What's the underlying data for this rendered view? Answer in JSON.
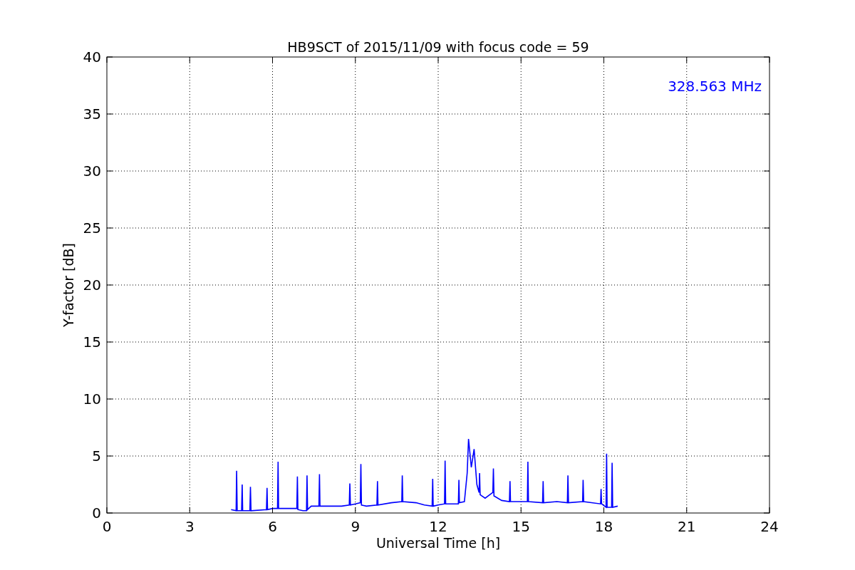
{
  "chart_data": {
    "type": "line",
    "title": "HB9SCT of 2015/11/09 with focus code = 59",
    "xlabel": "Universal Time [h]",
    "ylabel": "Y-factor [dB]",
    "x": [
      4.5,
      4.68,
      4.7,
      4.72,
      4.88,
      4.9,
      4.92,
      5.18,
      5.2,
      5.22,
      5.78,
      5.8,
      5.82,
      6.0,
      6.18,
      6.2,
      6.22,
      6.88,
      6.9,
      6.92,
      7.1,
      7.23,
      7.25,
      7.27,
      7.4,
      7.68,
      7.7,
      7.72,
      8.5,
      8.78,
      8.8,
      8.82,
      9.0,
      9.18,
      9.2,
      9.22,
      9.4,
      9.78,
      9.8,
      9.82,
      10.3,
      10.68,
      10.7,
      10.72,
      11.2,
      11.5,
      11.78,
      11.8,
      11.82,
      12.0,
      12.23,
      12.25,
      12.27,
      12.73,
      12.75,
      12.77,
      12.95,
      13.05,
      13.1,
      13.2,
      13.3,
      13.4,
      13.48,
      13.5,
      13.52,
      13.7,
      13.98,
      14.0,
      14.02,
      14.3,
      14.58,
      14.6,
      14.62,
      15.23,
      15.25,
      15.27,
      15.78,
      15.8,
      15.82,
      16.3,
      16.68,
      16.7,
      16.72,
      17.23,
      17.25,
      17.27,
      17.88,
      17.9,
      17.92,
      18.08,
      18.1,
      18.12,
      18.28,
      18.3,
      18.32,
      18.5
    ],
    "series": [
      {
        "name": "328.563 MHz",
        "color": "#0000ff",
        "values": [
          0.3,
          0.2,
          3.7,
          0.2,
          0.2,
          2.5,
          0.2,
          0.2,
          2.3,
          0.2,
          0.3,
          2.2,
          0.3,
          0.4,
          0.4,
          4.5,
          0.4,
          0.4,
          3.2,
          0.3,
          0.2,
          0.2,
          3.3,
          0.3,
          0.6,
          0.6,
          3.4,
          0.6,
          0.6,
          0.7,
          2.6,
          0.7,
          0.8,
          0.9,
          4.3,
          0.7,
          0.6,
          0.7,
          2.8,
          0.7,
          0.9,
          1.0,
          3.3,
          1.0,
          0.9,
          0.7,
          0.6,
          3.0,
          0.6,
          0.7,
          0.8,
          4.6,
          0.8,
          0.8,
          2.9,
          0.9,
          1.0,
          3.5,
          6.5,
          4.0,
          5.6,
          2.5,
          1.8,
          3.5,
          1.6,
          1.3,
          1.8,
          3.9,
          1.5,
          1.1,
          1.0,
          2.8,
          1.0,
          1.0,
          4.5,
          1.0,
          0.9,
          2.8,
          0.9,
          1.0,
          0.9,
          3.3,
          0.9,
          1.0,
          2.9,
          1.0,
          0.8,
          2.1,
          0.8,
          0.5,
          5.2,
          0.5,
          0.5,
          4.4,
          0.5,
          0.6
        ]
      }
    ],
    "xlim": [
      0,
      24
    ],
    "ylim": [
      0,
      40
    ],
    "xticks": [
      0,
      3,
      6,
      9,
      12,
      15,
      18,
      21,
      24
    ],
    "yticks": [
      0,
      5,
      10,
      15,
      20,
      25,
      30,
      35,
      40
    ],
    "grid": true
  }
}
